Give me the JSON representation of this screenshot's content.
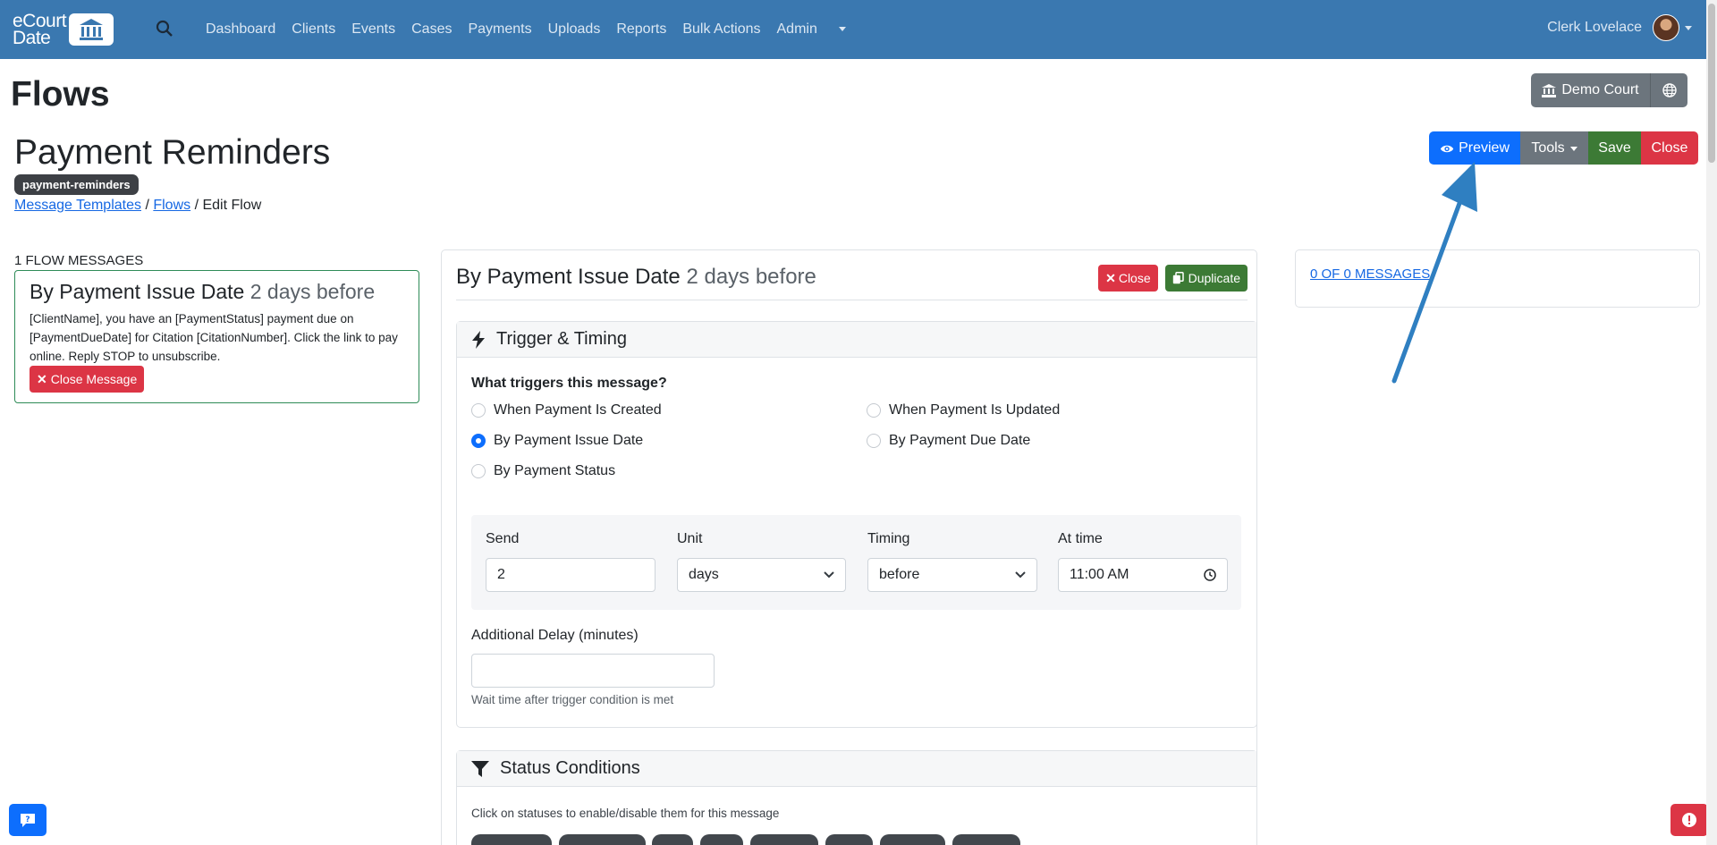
{
  "navbar": {
    "logo_line1": "eCourt",
    "logo_line2": "Date",
    "links": [
      "Dashboard",
      "Clients",
      "Events",
      "Cases",
      "Payments",
      "Uploads",
      "Reports",
      "Bulk Actions",
      "Admin"
    ],
    "user_name": "Clerk Lovelace"
  },
  "page": {
    "title": "Flows",
    "flow_name": "Payment Reminders",
    "flow_slug": "payment-reminders",
    "breadcrumb": {
      "templates": "Message Templates",
      "sep1": " / ",
      "flows": "Flows",
      "sep2": " / ",
      "current": "Edit Flow"
    }
  },
  "toolbar": {
    "court_label": "Demo Court",
    "preview": "Preview",
    "tools": "Tools",
    "save": "Save",
    "close": "Close"
  },
  "left": {
    "count_label": "1 FLOW MESSAGES",
    "card_title": "By Payment Issue Date",
    "card_timing": "2 days before",
    "card_body": "[ClientName], you have an [PaymentStatus] payment due on [PaymentDueDate] for Citation [CitationNumber]. Click the link to pay online. Reply STOP to unsubscribe.",
    "close_message": "Close Message"
  },
  "main": {
    "title": "By Payment Issue Date",
    "timing": "2 days before",
    "close": "Close",
    "duplicate": "Duplicate",
    "trigger_section": "Trigger & Timing",
    "trigger_question": "What triggers this message?",
    "triggers": [
      {
        "label": "When Payment Is Created",
        "selected": false
      },
      {
        "label": "When Payment Is Updated",
        "selected": false
      },
      {
        "label": "By Payment Issue Date",
        "selected": true
      },
      {
        "label": "By Payment Due Date",
        "selected": false
      },
      {
        "label": "By Payment Status",
        "selected": false
      }
    ],
    "send_label": "Send",
    "send_value": "2",
    "unit_label": "Unit",
    "unit_value": "days",
    "timing_label": "Timing",
    "timing_value": "before",
    "at_time_label": "At time",
    "at_time_value": "11:00 AM",
    "delay_label": "Additional Delay (minutes)",
    "delay_value": "",
    "delay_help": "Wait time after trigger condition is met",
    "status_section": "Status Conditions",
    "status_help": "Click on statuses to enable/disable them for this message"
  },
  "right": {
    "messages_link": "0 OF 0 MESSAGES"
  },
  "colors": {
    "navbar": "#3a78b0",
    "primary": "#0d6efd",
    "success": "#3c7a35",
    "danger": "#dc3545",
    "secondary": "#6c757d",
    "annotation_arrow": "#2f7fc1"
  }
}
